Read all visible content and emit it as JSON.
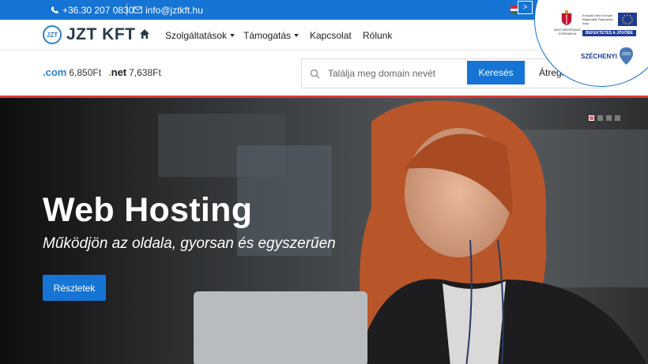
{
  "topbar": {
    "phone": "+36.30 207 0830",
    "email": "info@jztkft.hu",
    "next_label": ">"
  },
  "brand": {
    "logo_mark": "JZT",
    "name": "JZT KFT"
  },
  "nav": {
    "items": [
      {
        "label": "Szolgáltatások",
        "dropdown": true
      },
      {
        "label": "Támogatás",
        "dropdown": true
      },
      {
        "label": "Kapcsolat",
        "dropdown": false
      },
      {
        "label": "Rólunk",
        "dropdown": false
      }
    ]
  },
  "domains": {
    "com": {
      "ext": "com",
      "price": "6,850Ft"
    },
    "net": {
      "ext": "net",
      "price": "7,638Ft"
    },
    "search_placeholder": "Találja meg domain nevét",
    "search_button": "Keresés",
    "transfer_button": "Átregisztrálás"
  },
  "hero": {
    "title": "Web Hosting",
    "subtitle": "Működjön az oldala, gyorsan és egyszerűen",
    "cta": "Részletek",
    "slide_count": 4,
    "active_slide": 1
  },
  "badge": {
    "hu_text": "MAGYARORSZÁG KORMÁNYA",
    "eu_text": "Európai Unió Európai Regionális Fejlesztési Alap",
    "invest_text": "BEFEKTETÉS A JÖVŐBE",
    "szechenyi": "SZÉCHENYI",
    "year": "2020"
  },
  "colors": {
    "primary": "#1574d4",
    "accent_red": "#d93a3a",
    "eu_blue": "#1e3c96"
  }
}
